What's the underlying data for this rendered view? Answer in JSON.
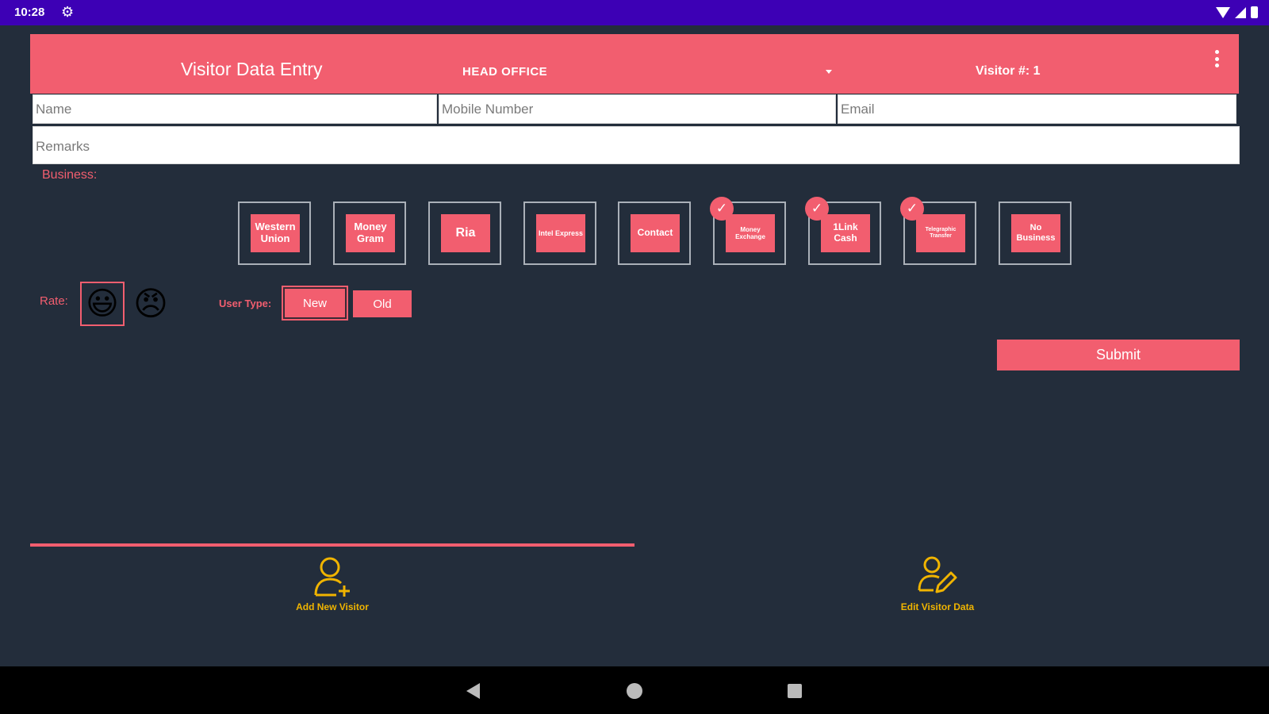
{
  "status_bar": {
    "time": "10:28"
  },
  "header": {
    "title": "Visitor Data Entry",
    "office_selected": "HEAD OFFICE",
    "visitor_number": "Visitor #: 1"
  },
  "form": {
    "name_placeholder": "Name",
    "mobile_placeholder": "Mobile Number",
    "email_placeholder": "Email",
    "remarks_placeholder": "Remarks"
  },
  "business": {
    "label": "Business:",
    "items": [
      {
        "label": "Western Union",
        "checked": false
      },
      {
        "label": "Money Gram",
        "checked": false
      },
      {
        "label": "Ria",
        "checked": false
      },
      {
        "label": "Intel Express",
        "checked": false
      },
      {
        "label": "Contact",
        "checked": false
      },
      {
        "label": "Money Exchange",
        "checked": true
      },
      {
        "label": "1Link Cash",
        "checked": true
      },
      {
        "label": "Telegraphic Transfer",
        "checked": true
      },
      {
        "label": "No Business",
        "checked": false
      }
    ]
  },
  "rate": {
    "label": "Rate:",
    "options": [
      "😃",
      "😠"
    ]
  },
  "user_type": {
    "label": "User Type:",
    "new_label": "New",
    "old_label": "Old"
  },
  "submit_label": "Submit",
  "tabs": {
    "add_label": "Add New Visitor",
    "edit_label": "Edit Visitor Data"
  },
  "colors": {
    "accent": "#f25e6f",
    "background": "#232d3b",
    "status_bar": "#3d00b5",
    "tab_icon": "#f0b400"
  }
}
